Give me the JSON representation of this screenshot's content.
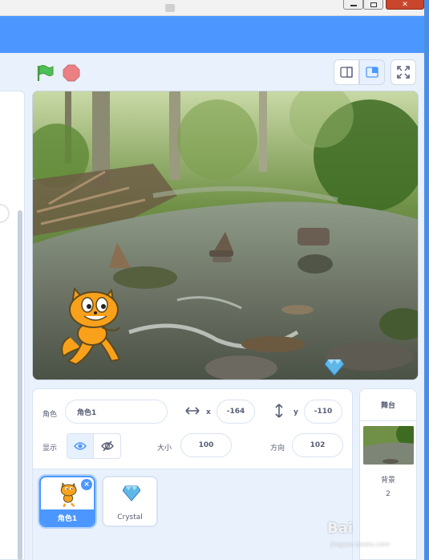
{
  "window": {
    "controls": [
      "minimize",
      "maximize",
      "close"
    ]
  },
  "run_controls": {
    "flag_icon": "green-flag-icon",
    "stop_icon": "stop-icon"
  },
  "stage_modes": [
    "small-stage-icon",
    "normal-stage-icon",
    "fullscreen-icon"
  ],
  "sprite_info": {
    "sprite_label": "角色",
    "sprite_name": "角色1",
    "x_label": "x",
    "x_value": "-164",
    "y_label": "y",
    "y_value": "-110",
    "show_label": "显示",
    "size_label": "大小",
    "size_value": "100",
    "direction_label": "方向",
    "direction_value": "102"
  },
  "sprites": [
    {
      "name": "角色1",
      "selected": true
    },
    {
      "name": "Crystal",
      "selected": false
    }
  ],
  "stage_panel": {
    "title": "舞台",
    "backdrops_label": "背景",
    "backdrops_count": "2"
  },
  "watermark": {
    "brand": "Bai",
    "sub": "jingyan.baidu.com"
  },
  "colors": {
    "accent": "#4c97ff",
    "menubar": "#4c97ff",
    "panel_bg": "#e9f1fc",
    "flag": "#4cbf56",
    "stop": "#ec5959"
  }
}
